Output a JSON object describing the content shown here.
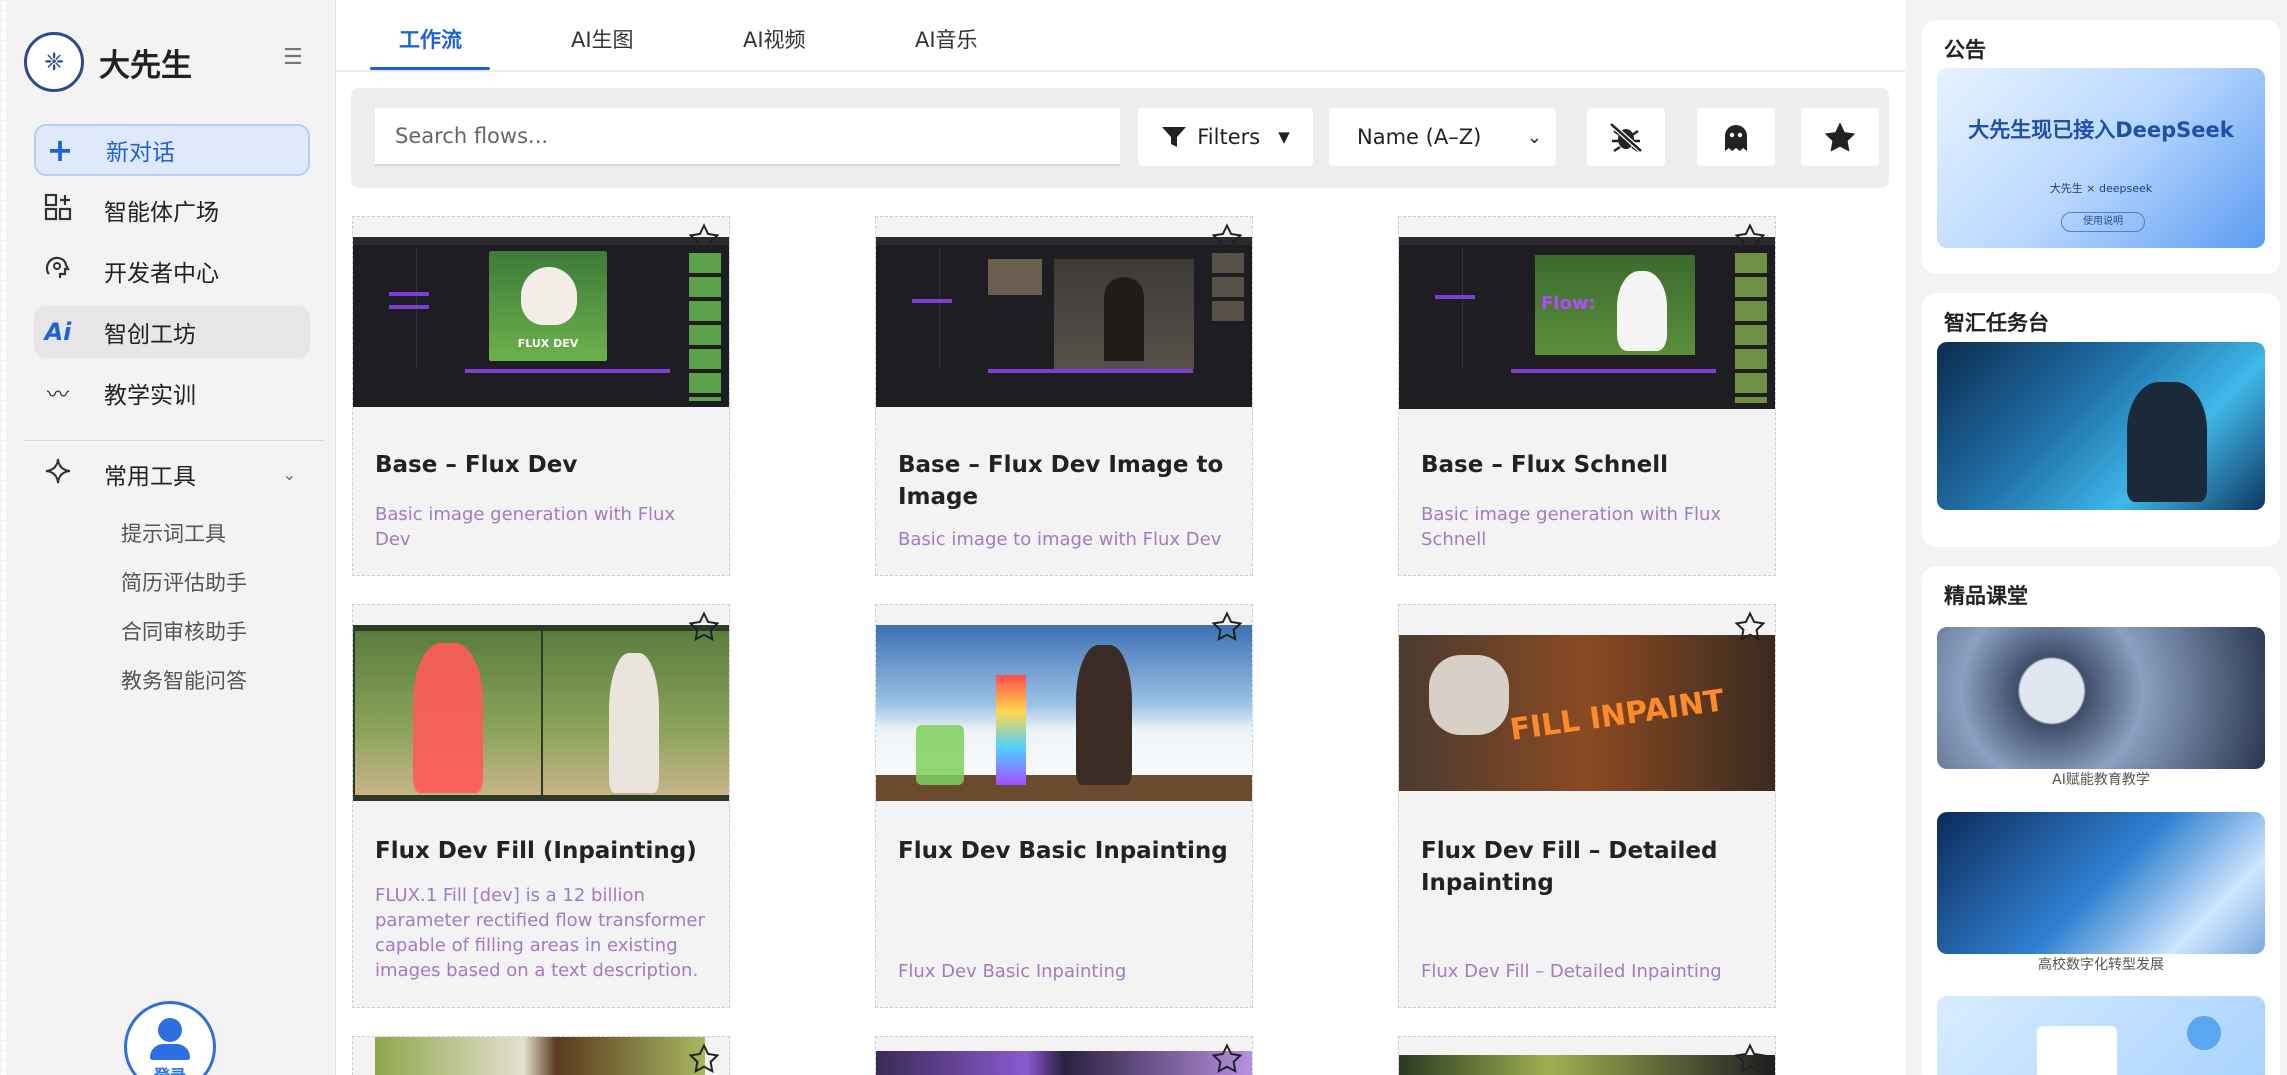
{
  "app": {
    "name": "大先生"
  },
  "sidebar": {
    "items": [
      {
        "label": "新对话",
        "icon": "plus-icon"
      },
      {
        "label": "智能体广场",
        "icon": "apps-grid-icon"
      },
      {
        "label": "开发者中心",
        "icon": "brain-gear-icon"
      },
      {
        "label": "智创工坊",
        "icon": "ai-icon"
      },
      {
        "label": "教学实训",
        "icon": "wave-icon"
      }
    ],
    "tools": {
      "label": "常用工具",
      "icon": "sparkle-icon",
      "sub": [
        "提示词工具",
        "简历评估助手",
        "合同审核助手",
        "教务智能问答"
      ]
    },
    "login_label": "登录"
  },
  "tabs": [
    "工作流",
    "AI生图",
    "AI视频",
    "AI音乐"
  ],
  "toolbar": {
    "search_placeholder": "Search flows...",
    "filters_label": "Filters",
    "sort_label": "Name (A–Z)"
  },
  "cards": [
    {
      "title": "Base – Flux Dev",
      "desc": "Basic image generation with Flux Dev"
    },
    {
      "title": "Base – Flux Dev Image to Image",
      "desc": "Basic image to image with Flux Dev"
    },
    {
      "title": "Base – Flux Schnell",
      "desc": "Basic image generation with Flux Schnell"
    },
    {
      "title": "Flux Dev Fill (Inpainting)",
      "desc": "FLUX.1 Fill [dev] is a 12 billion parameter rectified flow transformer capable of filling areas in existing images based on a text description."
    },
    {
      "title": "Flux Dev Basic Inpainting",
      "desc": "Flux Dev Basic Inpainting"
    },
    {
      "title": "Flux Dev Fill – Detailed Inpainting",
      "desc": "Flux Dev Fill – Detailed Inpainting"
    }
  ],
  "thumbs": {
    "flux_dev": "FLUX DEV",
    "flux_schnell": "Flow:",
    "inpaint": "FILL INPAINT"
  },
  "right": {
    "notice": {
      "title": "公告",
      "banner": "大先生现已接入DeepSeek",
      "banner_sub": "大先生 × deepseek",
      "banner_btn": "使用说明"
    },
    "task": {
      "title": "智汇任务台"
    },
    "courses": {
      "title": "精品课堂",
      "items": [
        "AI赋能教育教学",
        "高校数字化转型发展"
      ]
    }
  }
}
